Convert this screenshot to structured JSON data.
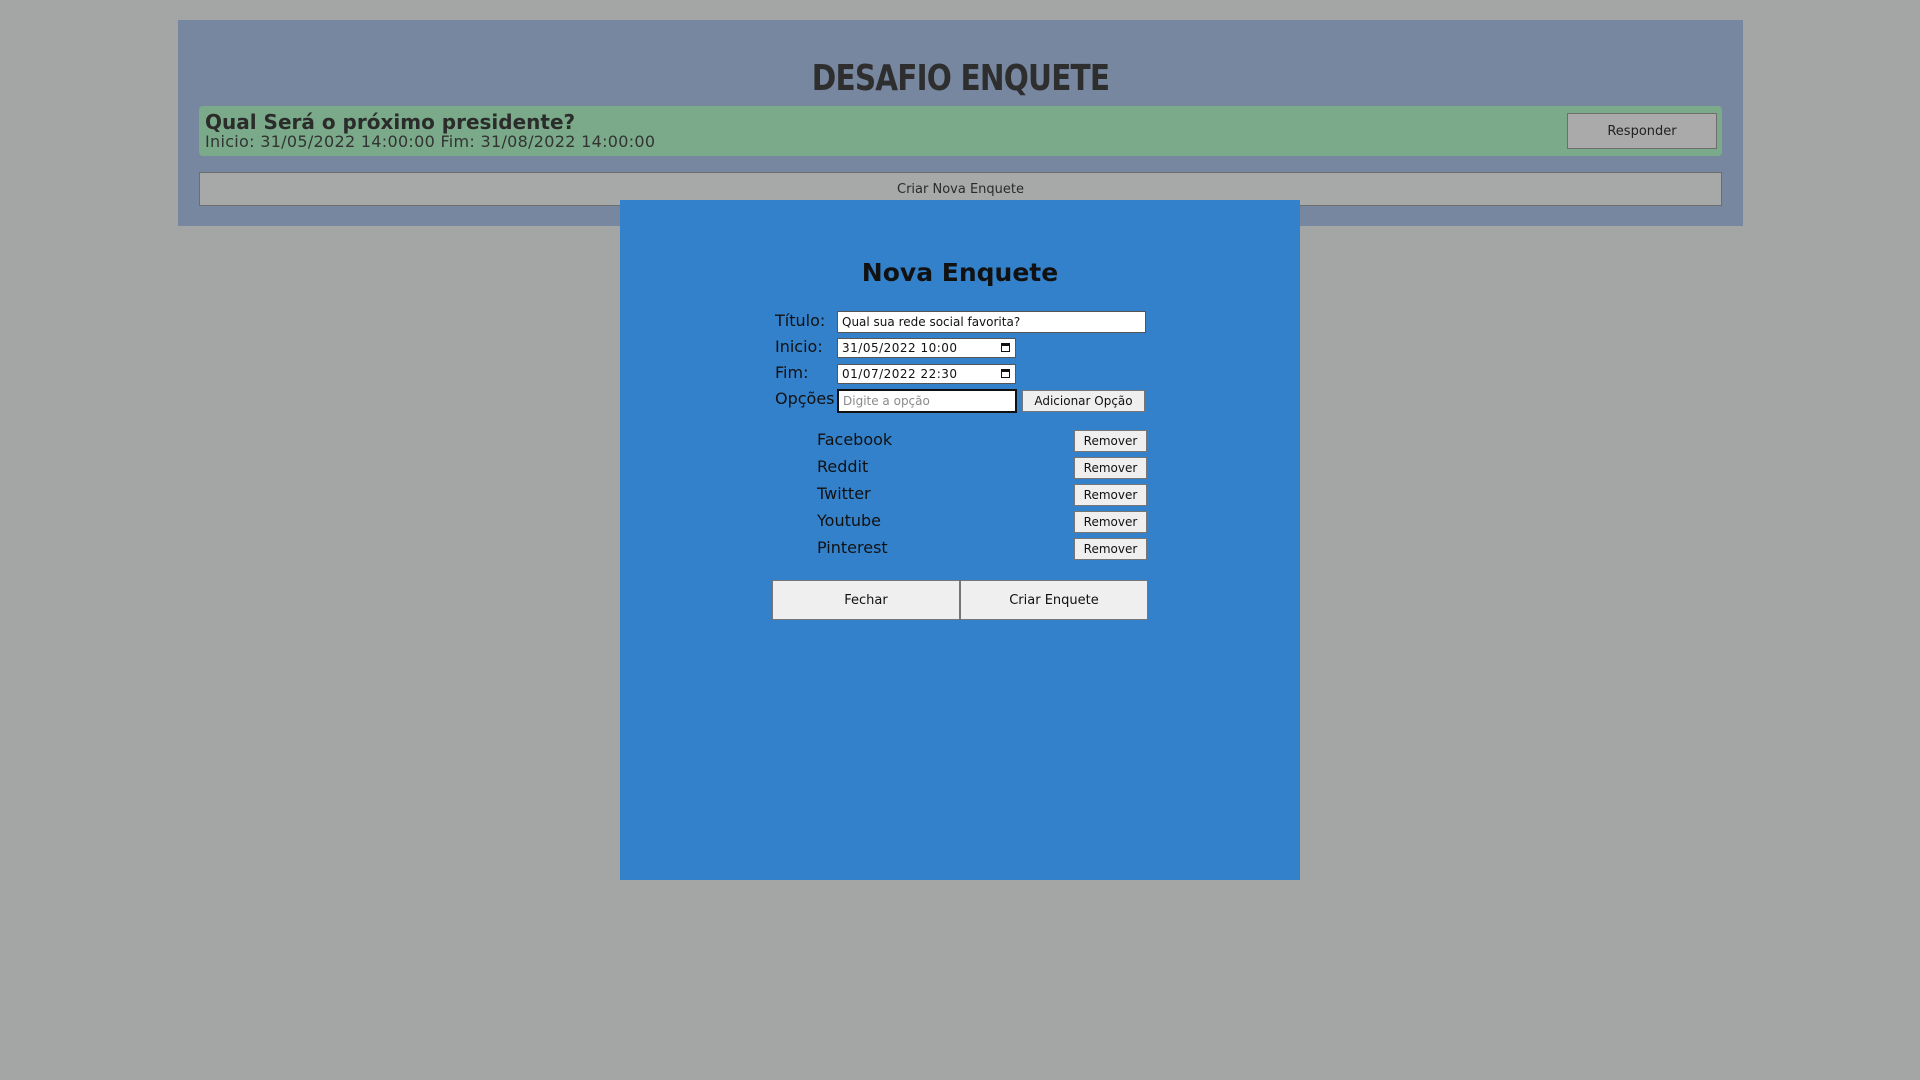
{
  "app": {
    "title": "DESAFIO ENQUETE"
  },
  "poll": {
    "question": "Qual Será o próximo presidente?",
    "dates": "Inicio: 31/05/2022 14:00:00 Fim: 31/08/2022 14:00:00",
    "respond_label": "Responder"
  },
  "create_new_label": "Criar Nova Enquete",
  "modal": {
    "title": "Nova Enquete",
    "title_label": "Título:",
    "title_value": "Qual sua rede social favorita?",
    "start_label": "Inicio:",
    "start_value": "31/05/2022 10:00",
    "end_label": "Fim:",
    "end_value": "01/07/2022 22:30",
    "options_label": "Opções",
    "option_placeholder": "Digite a opção",
    "add_option_label": "Adicionar Opção",
    "options": [
      {
        "label": "Facebook",
        "remove_label": "Remover"
      },
      {
        "label": "Reddit",
        "remove_label": "Remover"
      },
      {
        "label": "Twitter",
        "remove_label": "Remover"
      },
      {
        "label": "Youtube",
        "remove_label": "Remover"
      },
      {
        "label": "Pinterest",
        "remove_label": "Remover"
      }
    ],
    "close_label": "Fechar",
    "submit_label": "Criar Enquete"
  },
  "colors": {
    "page_background": "#a4a6a5",
    "app_panel": "#77879f",
    "poll_card": "#7aaa89",
    "modal_background": "#3281ca"
  },
  "icons": {
    "date_picker": "calendar-icon"
  }
}
